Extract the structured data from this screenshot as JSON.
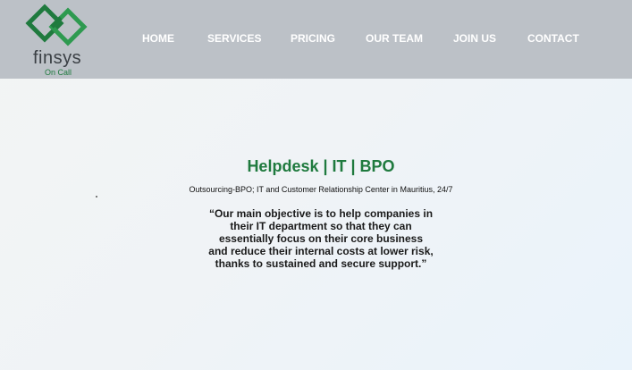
{
  "brand": {
    "name": "finsys",
    "tagline": "On Call",
    "logo_icon": "interlocking-diamonds-logo-icon",
    "colors": {
      "primary_green": "#1f7a3e",
      "light_green": "#2e9a50",
      "header_bg": "#bcc1c7"
    }
  },
  "nav": {
    "items": [
      {
        "label": "HOME"
      },
      {
        "label": "SERVICES"
      },
      {
        "label": "PRICING"
      },
      {
        "label": "OUR TEAM"
      },
      {
        "label": "JOIN US"
      },
      {
        "label": "CONTACT"
      }
    ]
  },
  "hero": {
    "title": "Helpdesk | IT | BPO",
    "subtitle": "Outsourcing-BPO; IT and Customer Relationship Center in Mauritius, 24/7",
    "quote_lines": [
      "“Our main objective is to help companies in",
      "their IT department so that they can",
      "essentially focus on their core business",
      "and reduce their internal costs at lower risk,",
      "thanks to sustained and secure support.”"
    ]
  }
}
